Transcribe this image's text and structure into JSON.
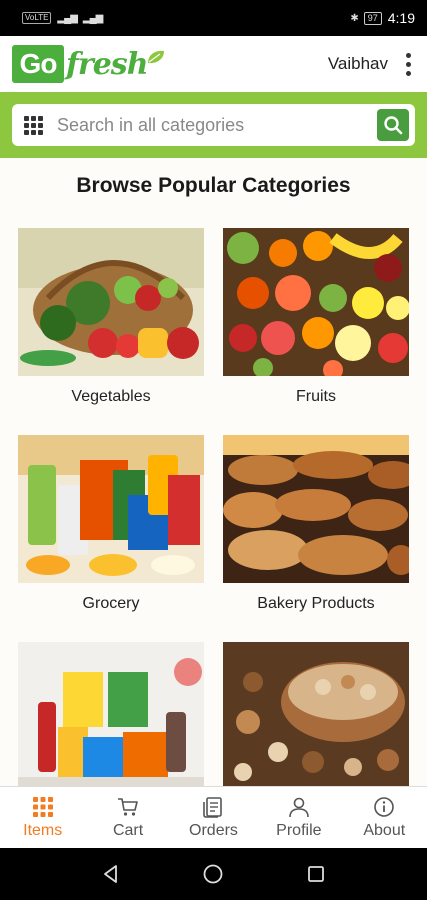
{
  "status_bar": {
    "carrier_badge": "VoLTE",
    "battery": "97",
    "time": "4:19"
  },
  "header": {
    "logo_go": "Go",
    "logo_fresh": "fresh",
    "username": "Vaibhav"
  },
  "search": {
    "placeholder": "Search in all categories"
  },
  "main": {
    "section_title": "Browse Popular Categories",
    "categories": [
      {
        "label": "Vegetables"
      },
      {
        "label": "Fruits"
      },
      {
        "label": "Grocery"
      },
      {
        "label": "Bakery Products"
      },
      {
        "label": ""
      },
      {
        "label": ""
      }
    ]
  },
  "bottom_nav": {
    "items": [
      {
        "label": "Items",
        "icon": "grid-icon",
        "active": true
      },
      {
        "label": "Cart",
        "icon": "cart-icon"
      },
      {
        "label": "Orders",
        "icon": "orders-icon"
      },
      {
        "label": "Profile",
        "icon": "profile-icon"
      },
      {
        "label": "About",
        "icon": "info-icon"
      }
    ]
  },
  "colors": {
    "brand_green": "#4cae3d",
    "search_band": "#8dc63f",
    "active_nav": "#f47c20"
  }
}
